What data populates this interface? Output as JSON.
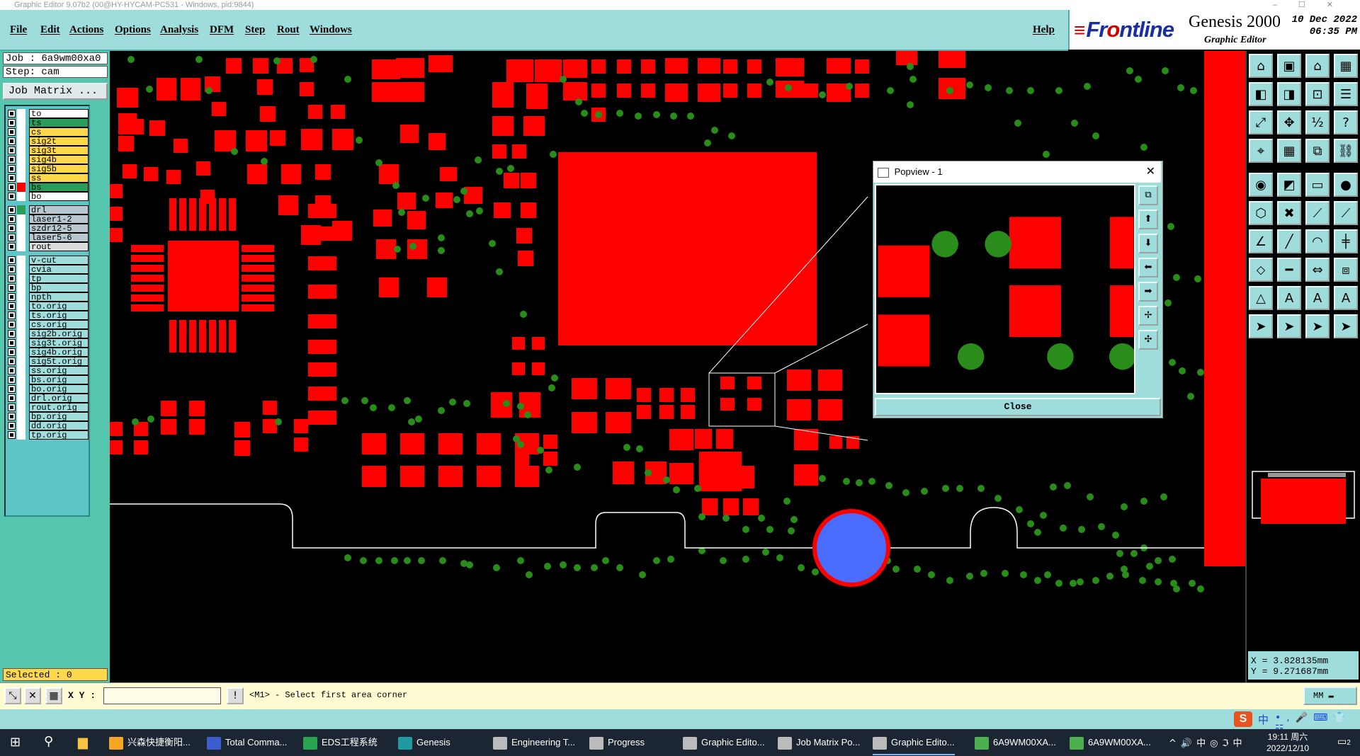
{
  "window": {
    "title": "Graphic Editor 9.07b2 (00@HY-HYCAM-PC531 - Windows, pid:9844)"
  },
  "menu": [
    "File",
    "Edit",
    "Actions",
    "Options",
    "Analysis",
    "DFM",
    "Step",
    "Rout",
    "Windows"
  ],
  "help_label": "Help",
  "brand": {
    "logo": "Frontline",
    "product": "Genesis 2000",
    "subtitle": "Graphic Editor",
    "date": "10 Dec 2022",
    "time": "06:35 PM"
  },
  "job": {
    "label": "Job : 6a9wm00xa0",
    "step": "Step: cam",
    "matrix_button": "Job Matrix ..."
  },
  "layers": [
    {
      "name": "to",
      "color": "#ffffff",
      "swatch": "#ffffff"
    },
    {
      "name": "ts",
      "color": "#2a9d5b",
      "swatch": "#ffffff"
    },
    {
      "name": "cs",
      "color": "#ffd94a",
      "swatch": "#ffffff"
    },
    {
      "name": "sig2t",
      "color": "#ffd94a",
      "swatch": "#ffffff"
    },
    {
      "name": "sig3t",
      "color": "#ffd94a",
      "swatch": "#ffffff"
    },
    {
      "name": "sig4b",
      "color": "#ffd94a",
      "swatch": "#ffffff"
    },
    {
      "name": "sig5b",
      "color": "#ffd94a",
      "swatch": "#ffffff"
    },
    {
      "name": "ss",
      "color": "#ffd94a",
      "swatch": "#ffffff"
    },
    {
      "name": "bs",
      "color": "#2a9d5b",
      "swatch": "#ff0000"
    },
    {
      "name": "bo",
      "color": "#ffffff",
      "swatch": "#ffffff"
    },
    {
      "name": "drl",
      "color": "#b8c8d0",
      "swatch": "#2a9d5b"
    },
    {
      "name": "laser1-2",
      "color": "#b8c8d0",
      "swatch": "#ffffff"
    },
    {
      "name": "szdr12-5",
      "color": "#b8c8d0",
      "swatch": "#ffffff"
    },
    {
      "name": "laser5-6",
      "color": "#b8c8d0",
      "swatch": "#ffffff"
    },
    {
      "name": "rout",
      "color": "#dcdcdc",
      "swatch": "#ffffff"
    },
    {
      "name": "v-cut",
      "color": "#9fdcdc",
      "swatch": "#ffffff"
    },
    {
      "name": "cvia",
      "color": "#9fdcdc",
      "swatch": "#ffffff"
    },
    {
      "name": "tp",
      "color": "#9fdcdc",
      "swatch": "#ffffff"
    },
    {
      "name": "bp",
      "color": "#9fdcdc",
      "swatch": "#ffffff"
    },
    {
      "name": "npth",
      "color": "#9fdcdc",
      "swatch": "#ffffff"
    },
    {
      "name": "to.orig",
      "color": "#9fdcdc",
      "swatch": "#ffffff"
    },
    {
      "name": "ts.orig",
      "color": "#9fdcdc",
      "swatch": "#ffffff"
    },
    {
      "name": "cs.orig",
      "color": "#9fdcdc",
      "swatch": "#ffffff"
    },
    {
      "name": "sig2b.orig",
      "color": "#9fdcdc",
      "swatch": "#ffffff"
    },
    {
      "name": "sig3t.orig",
      "color": "#9fdcdc",
      "swatch": "#ffffff"
    },
    {
      "name": "sig4b.orig",
      "color": "#9fdcdc",
      "swatch": "#ffffff"
    },
    {
      "name": "sig5t.orig",
      "color": "#9fdcdc",
      "swatch": "#ffffff"
    },
    {
      "name": "ss.orig",
      "color": "#9fdcdc",
      "swatch": "#ffffff"
    },
    {
      "name": "bs.orig",
      "color": "#9fdcdc",
      "swatch": "#ffffff"
    },
    {
      "name": "bo.orig",
      "color": "#9fdcdc",
      "swatch": "#ffffff"
    },
    {
      "name": "drl.orig",
      "color": "#9fdcdc",
      "swatch": "#ffffff"
    },
    {
      "name": "rout.orig",
      "color": "#9fdcdc",
      "swatch": "#ffffff"
    },
    {
      "name": "bp.orig",
      "color": "#9fdcdc",
      "swatch": "#ffffff"
    },
    {
      "name": "dd.orig",
      "color": "#9fdcdc",
      "swatch": "#ffffff"
    },
    {
      "name": "tp.orig",
      "color": "#9fdcdc",
      "swatch": "#ffffff"
    }
  ],
  "selected": "Selected : 0",
  "coords": {
    "x": "X = 3.828135mm",
    "y": "Y = 9.271687mm"
  },
  "command": {
    "xy_label": "X Y :",
    "xy_value": "",
    "prompt": "<M1> - Select first area corner",
    "unit": "MM"
  },
  "popview": {
    "title": "Popview - 1",
    "close_label": "Close"
  },
  "colors": {
    "pad": "#ff0000",
    "via": "#2a8c1a",
    "hole": "#4a6cff",
    "panel": "#9fdcdc",
    "leftpanel": "#55c5ad"
  },
  "taskbar": {
    "items": [
      "兴森快捷衡阳...",
      "Total Comma...",
      "EDS工程系统",
      "Genesis",
      "Engineering T...",
      "Progress",
      "Graphic Edito...",
      "Job Matrix Po...",
      "Graphic Edito...",
      "6A9WM00XA...",
      "6A9WM00XA..."
    ],
    "ime": "中",
    "clock_time": "19:11 周六",
    "clock_date": "2022/12/10",
    "notif": "2"
  }
}
